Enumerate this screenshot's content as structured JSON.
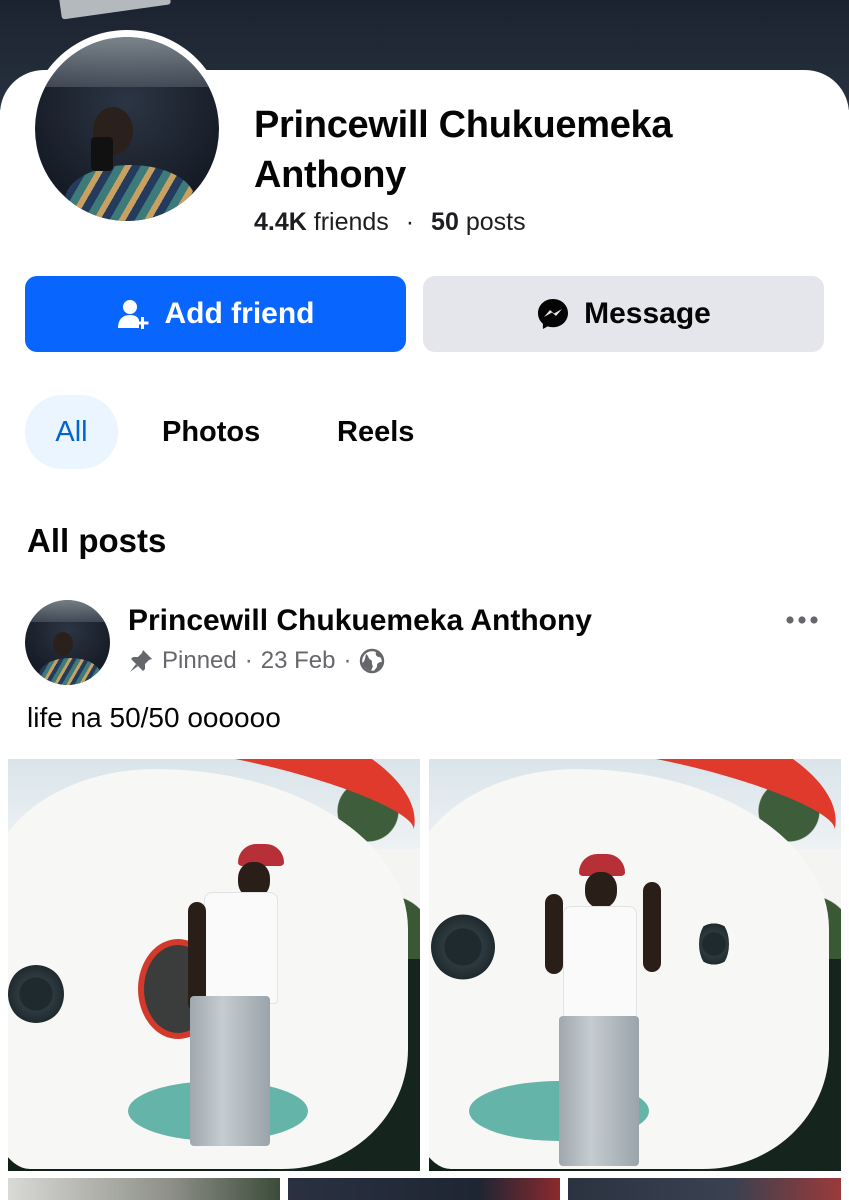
{
  "profile": {
    "name": "Princewill Chukuemeka Anthony",
    "friends_count": "4.4K",
    "friends_label": "friends",
    "separator": "·",
    "posts_count": "50",
    "posts_label": "posts"
  },
  "actions": {
    "add_friend": "Add friend",
    "message": "Message"
  },
  "tabs": [
    {
      "label": "All",
      "active": true
    },
    {
      "label": "Photos",
      "active": false
    },
    {
      "label": "Reels",
      "active": false
    }
  ],
  "section_title": "All posts",
  "post": {
    "author": "Princewill Chukuemeka Anthony",
    "pinned_label": "Pinned",
    "separator": "·",
    "date": "23 Feb",
    "visibility_icon": "globe-icon",
    "text": "life na 50/50 oooooo",
    "photos": [
      "photo-1",
      "photo-2"
    ]
  },
  "colors": {
    "primary": "#0866ff",
    "secondary_button": "#e4e6eb",
    "active_tab_bg": "#ebf5ff",
    "active_tab_text": "#0064d1",
    "muted_text": "#65676b"
  }
}
